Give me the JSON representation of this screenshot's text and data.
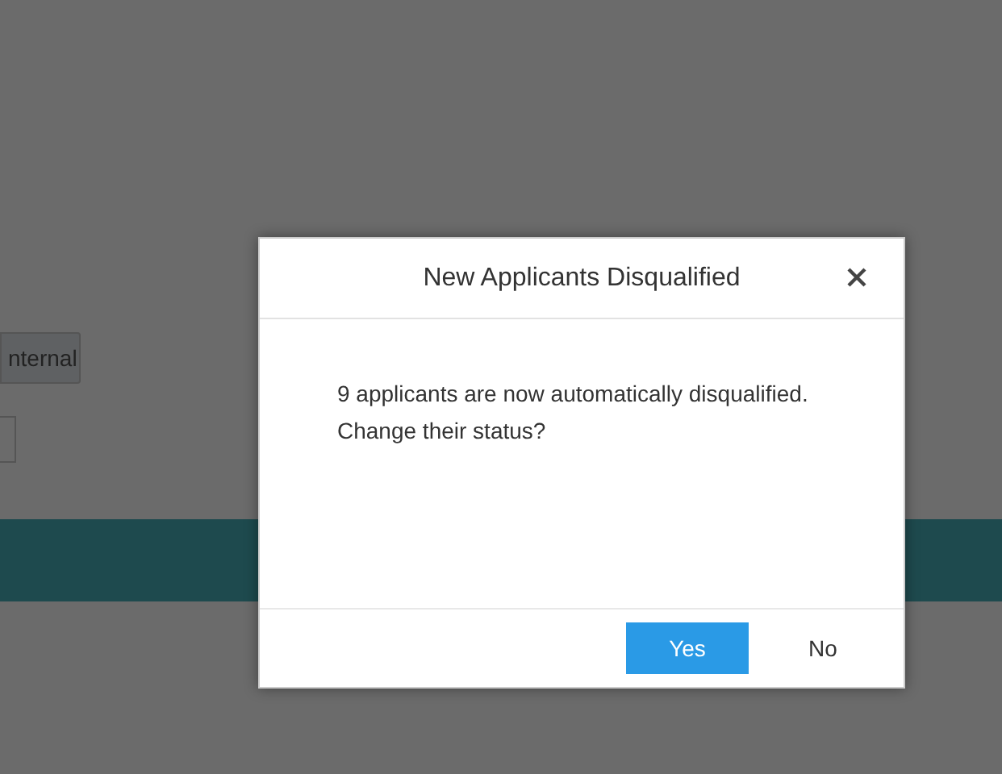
{
  "background": {
    "button": "nternal"
  },
  "dialog": {
    "title": "New Applicants Disqualified",
    "message": "9 applicants are now automatically disqualified.",
    "question": "Change their status?",
    "buttons": [
      {
        "label": "Yes",
        "kind": "primary"
      },
      {
        "label": "No",
        "kind": "plain"
      }
    ]
  }
}
